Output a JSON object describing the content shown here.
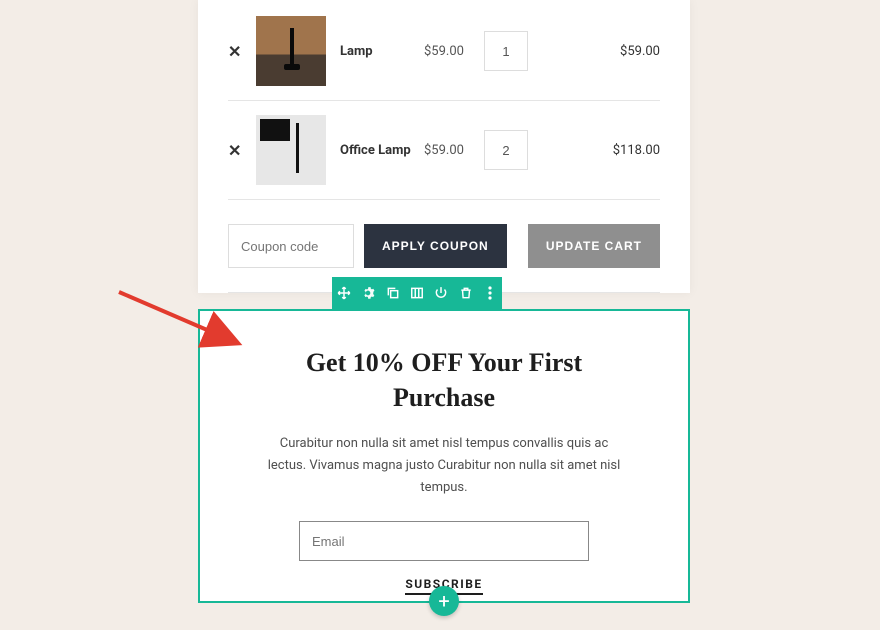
{
  "cart": {
    "items": [
      {
        "name": "Lamp",
        "price": "$59.00",
        "qty": "1",
        "subtotal": "$59.00"
      },
      {
        "name": "Office Lamp",
        "price": "$59.00",
        "qty": "2",
        "subtotal": "$118.00"
      }
    ],
    "coupon_placeholder": "Coupon code",
    "apply_label": "APPLY COUPON",
    "update_label": "UPDATE CART"
  },
  "promo": {
    "heading": "Get 10% OFF Your First Purchase",
    "body": "Curabitur non nulla sit amet nisl tempus convallis quis ac lectus. Vivamus magna justo Curabitur non nulla sit amet nisl tempus.",
    "email_placeholder": "Email",
    "subscribe_label": "SUBSCRIBE"
  },
  "editor": {
    "icons": [
      "move-icon",
      "gear-icon",
      "duplicate-icon",
      "columns-icon",
      "power-icon",
      "trash-icon",
      "more-icon"
    ]
  },
  "colors": {
    "accent": "#17b897",
    "dark": "#2c3340"
  }
}
